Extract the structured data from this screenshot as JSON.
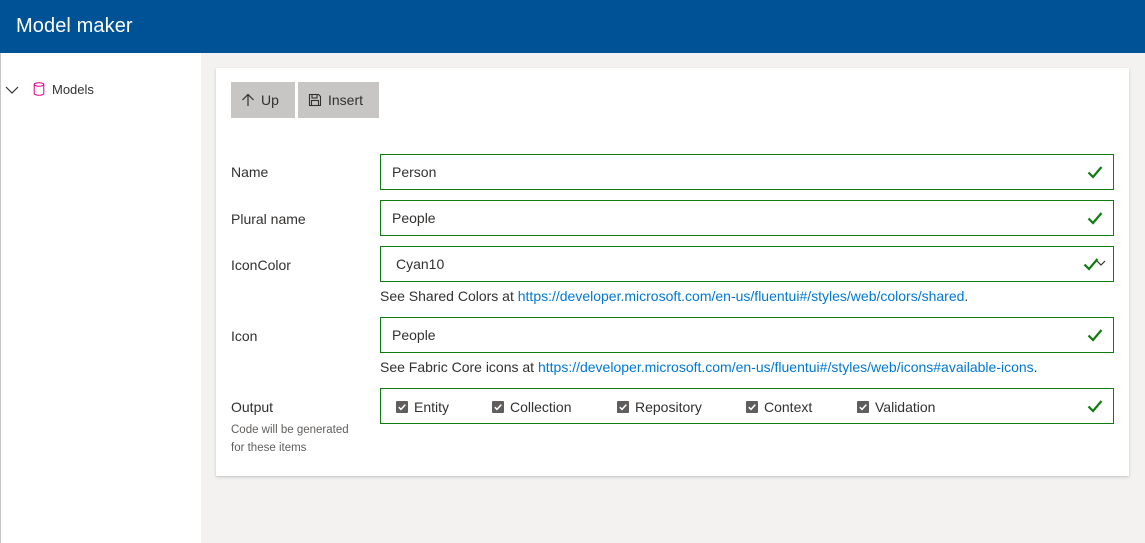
{
  "app": {
    "title": "Model maker"
  },
  "sidebar": {
    "items": [
      {
        "label": "Models",
        "expanded": true,
        "icon": "database-icon",
        "icon_color": "#e3008c"
      }
    ]
  },
  "toolbar": {
    "up_label": "Up",
    "insert_label": "Insert",
    "up_icon": "arrow-up-icon",
    "insert_icon": "save-icon"
  },
  "form": {
    "name": {
      "label": "Name",
      "value": "Person"
    },
    "plural": {
      "label": "Plural name",
      "value": "People"
    },
    "icon_color": {
      "label": "IconColor",
      "value": "Cyan10",
      "hint_prefix": "See Shared Colors at ",
      "hint_link": "https://developer.microsoft.com/en-us/fluentui#/styles/web/colors/shared",
      "hint_suffix": "."
    },
    "icon": {
      "label": "Icon",
      "value": "People",
      "hint_prefix": "See Fabric Core icons at ",
      "hint_link": "https://developer.microsoft.com/en-us/fluentui#/styles/web/icons#available-icons",
      "hint_suffix": "."
    },
    "output": {
      "label": "Output",
      "sublabel_line1": "Code will be generated",
      "sublabel_line2": "for these items",
      "options": [
        {
          "label": "Entity",
          "checked": true
        },
        {
          "label": "Collection",
          "checked": true
        },
        {
          "label": "Repository",
          "checked": true
        },
        {
          "label": "Context",
          "checked": true
        },
        {
          "label": "Validation",
          "checked": true
        }
      ]
    }
  },
  "colors": {
    "header_bg": "#005296",
    "valid_border": "#107c10",
    "valid_check": "#107c10",
    "link": "#0078d4",
    "button_bg": "#c8c6c4"
  }
}
